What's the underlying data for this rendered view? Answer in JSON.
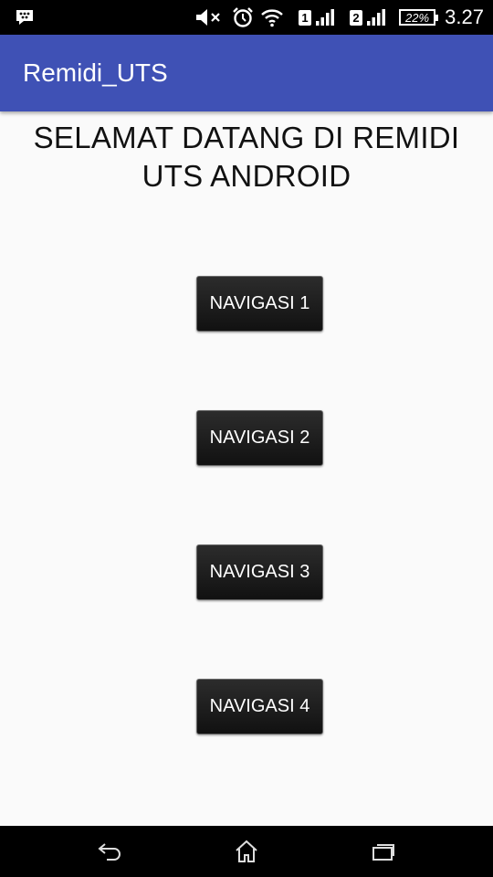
{
  "status_bar": {
    "time": "3.27",
    "battery_percent": "22%",
    "sim1_label": "1",
    "sim2_label": "2",
    "icons": [
      "bbm-icon",
      "mute-icon",
      "alarm-icon",
      "wifi-icon",
      "signal-icon",
      "signal-icon",
      "battery-icon"
    ]
  },
  "app_bar": {
    "title": "Remidi_UTS",
    "color": "#3f51b5"
  },
  "main": {
    "welcome_text": "SELAMAT DATANG DI REMIDI UTS ANDROID",
    "buttons": [
      {
        "label": "NAVIGASI 1"
      },
      {
        "label": "NAVIGASI 2"
      },
      {
        "label": "NAVIGASI 3"
      },
      {
        "label": "NAVIGASI 4"
      }
    ]
  },
  "nav_bar": {
    "keys": [
      "back-icon",
      "home-icon",
      "recent-apps-icon"
    ]
  }
}
